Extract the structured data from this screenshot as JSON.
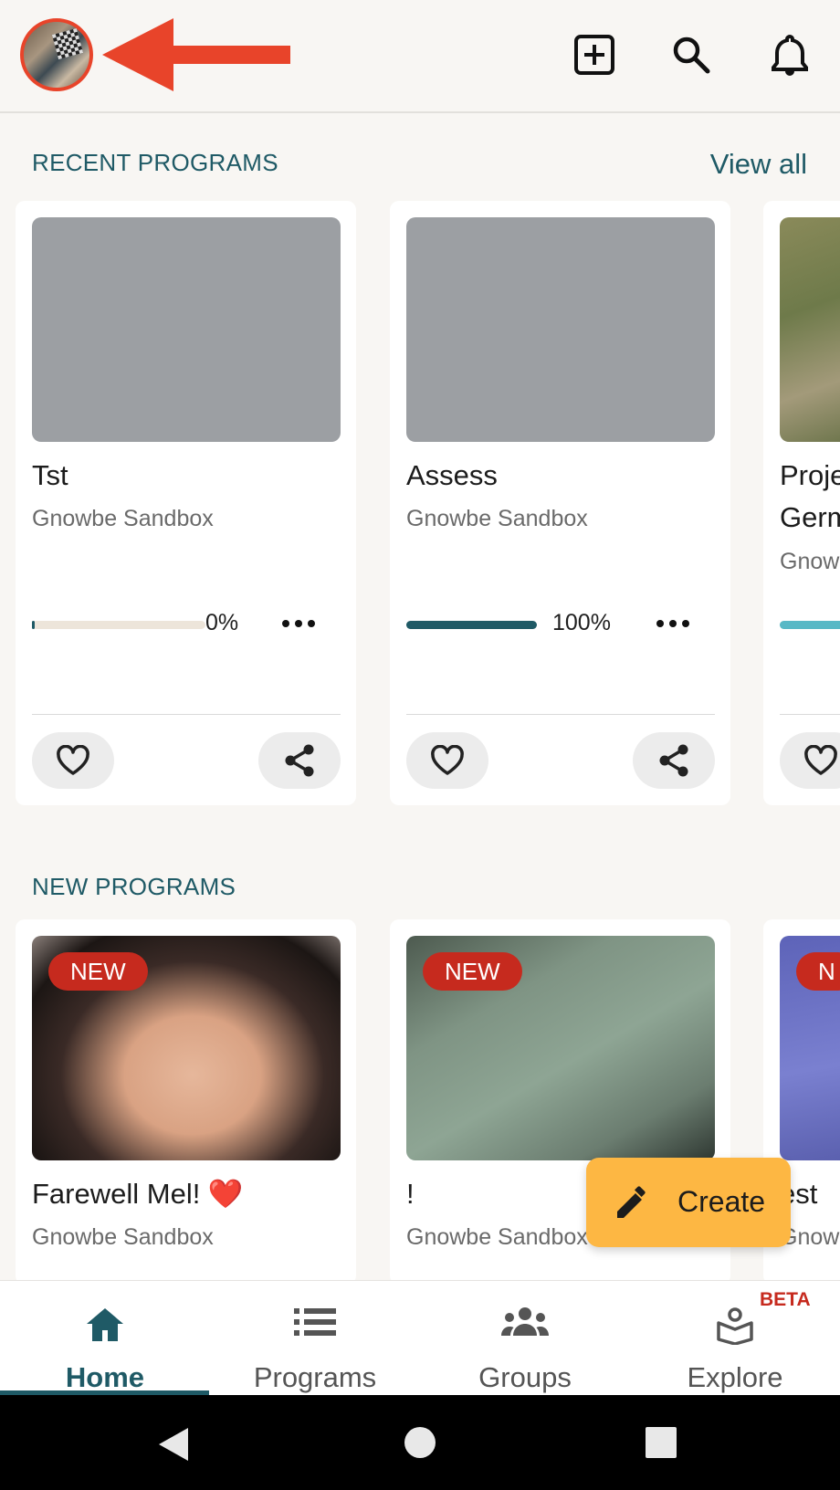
{
  "header": {
    "avatar_alt": "profile avatar",
    "icons": [
      "add-box-icon",
      "search-icon",
      "bell-icon"
    ]
  },
  "recent": {
    "title": "RECENT PROGRAMS",
    "view_all": "View all",
    "cards": [
      {
        "title": "Tst",
        "subtitle": "Gnowbe Sandbox",
        "progress_label": "0%",
        "progress": 0.0
      },
      {
        "title": "Assess",
        "subtitle": "Gnowbe Sandbox",
        "progress_label": "100%",
        "progress": 1.0
      },
      {
        "title_line1": "Proje",
        "title_line2": "Germ",
        "subtitle": "Gnow",
        "progress": 0.6
      }
    ]
  },
  "newprog": {
    "title": "NEW PROGRAMS",
    "badge": "NEW",
    "cards": [
      {
        "title": "Farewell Mel! ❤️",
        "subtitle": "Gnowbe Sandbox"
      },
      {
        "title": "!",
        "subtitle": "Gnowbe Sandbox"
      },
      {
        "title": "est",
        "subtitle": "Gnow",
        "badge": "N"
      }
    ]
  },
  "fab": {
    "label": "Create"
  },
  "nav": {
    "items": [
      {
        "label": "Home",
        "icon": "home-icon",
        "active": true
      },
      {
        "label": "Programs",
        "icon": "list-icon"
      },
      {
        "label": "Groups",
        "icon": "groups-icon"
      },
      {
        "label": "Explore",
        "icon": "explore-icon"
      }
    ],
    "beta": "BETA"
  },
  "colors": {
    "accent": "#1f5a66",
    "badge": "#c62a1e",
    "fab": "#fdb743",
    "arrow": "#e8442a",
    "progress_teal": "#57b8c6"
  }
}
